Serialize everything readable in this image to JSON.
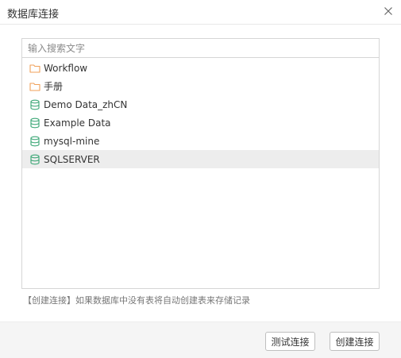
{
  "dialog": {
    "title": "数据库连接"
  },
  "search": {
    "placeholder": "输入搜索文字"
  },
  "items": [
    {
      "label": "Workflow",
      "icon": "folder-icon",
      "selected": false
    },
    {
      "label": "手册",
      "icon": "folder-icon",
      "selected": false
    },
    {
      "label": "Demo Data_zhCN",
      "icon": "database-icon",
      "selected": false
    },
    {
      "label": "Example Data",
      "icon": "database-icon",
      "selected": false
    },
    {
      "label": "mysql-mine",
      "icon": "database-icon",
      "selected": false
    },
    {
      "label": "SQLSERVER",
      "icon": "database-icon",
      "selected": true
    }
  ],
  "hint": "【创建连接】如果数据库中没有表将自动创建表来存储记录",
  "buttons": {
    "test": "测试连接",
    "create": "创建连接"
  },
  "colors": {
    "folder": "#f0a15a",
    "database": "#3aa675",
    "selected_bg": "#ededed"
  }
}
